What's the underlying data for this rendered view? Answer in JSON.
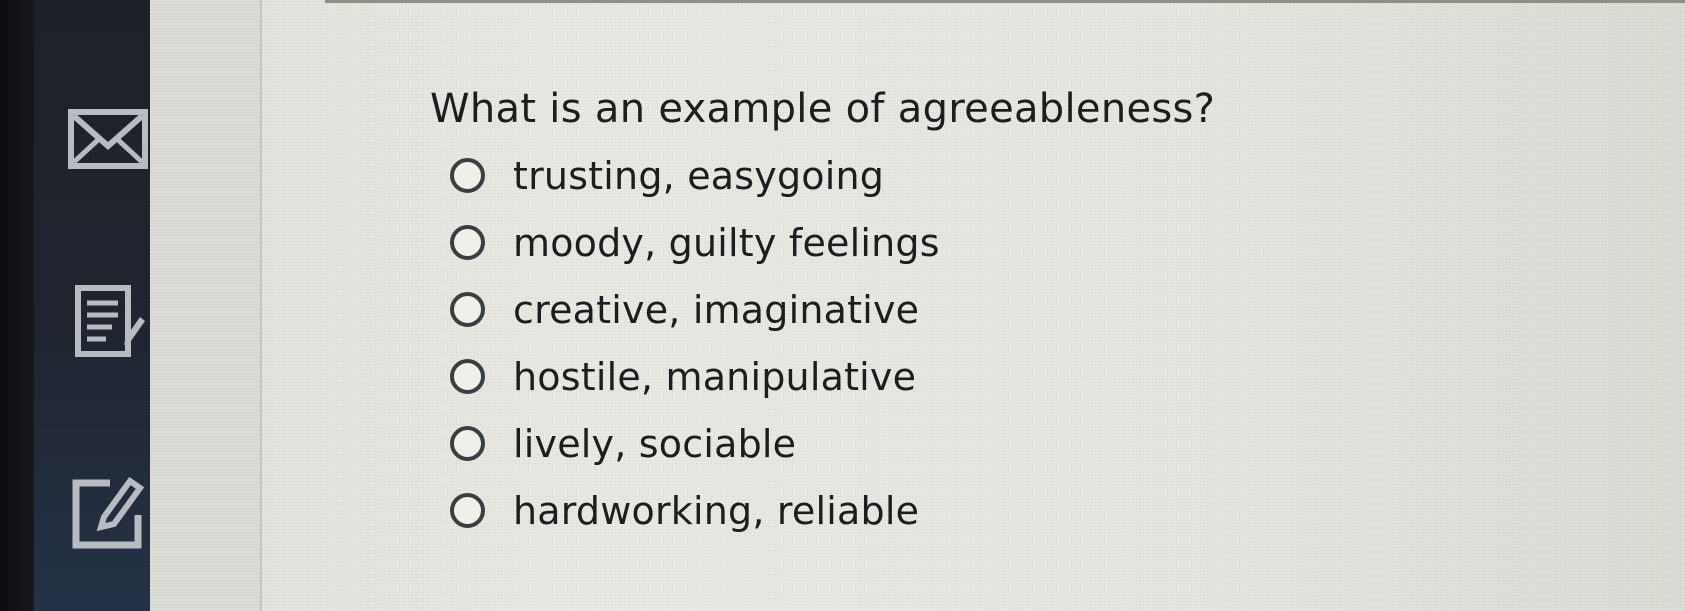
{
  "sidebar": {
    "icons": [
      {
        "name": "mail-icon"
      },
      {
        "name": "notes-icon"
      },
      {
        "name": "edit-icon"
      }
    ]
  },
  "question": {
    "text": "What is an example of agreeableness?",
    "options": [
      {
        "label": "trusting, easygoing",
        "selected": false
      },
      {
        "label": "moody, guilty feelings",
        "selected": false
      },
      {
        "label": "creative, imaginative",
        "selected": false
      },
      {
        "label": "hostile, manipulative",
        "selected": false
      },
      {
        "label": "lively, sociable",
        "selected": false
      },
      {
        "label": "hardworking, reliable",
        "selected": false
      }
    ]
  },
  "colors": {
    "sidebar_bg": "#202530",
    "content_bg": "#e6e7e1",
    "text": "#1d1d1f",
    "icon": "#b8bcc2"
  }
}
